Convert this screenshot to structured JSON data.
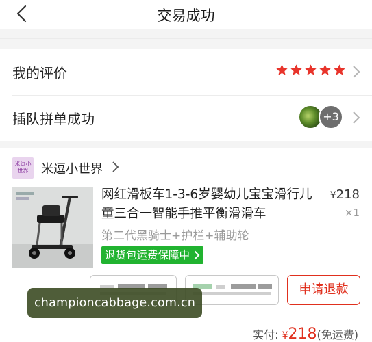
{
  "header": {
    "title": "交易成功"
  },
  "review": {
    "label": "我的评价",
    "stars": 5,
    "star_color": "#e8342b"
  },
  "group": {
    "label": "插队拼单成功",
    "extra_count": "+3"
  },
  "shop": {
    "logo_text": "米逗小\n世界",
    "name": "米逗小世界"
  },
  "item": {
    "title": "网红滑板车1-3-6岁婴幼儿宝宝滑行儿童三合一智能手推平衡滑滑车",
    "spec": "第二代黑骑士+护栏+辅助轮",
    "badge": "退货包运费保障中",
    "price_symbol": "¥",
    "price": "218",
    "quantity": "×1"
  },
  "actions": {
    "refund_label": "申请退款"
  },
  "summary": {
    "label": "实付:",
    "symbol": "¥",
    "amount": "218",
    "note": "(免运费)"
  },
  "watermark": "championcabbage.com.cn",
  "colors": {
    "accent_red": "#e0301e",
    "badge_green": "#21b330"
  }
}
